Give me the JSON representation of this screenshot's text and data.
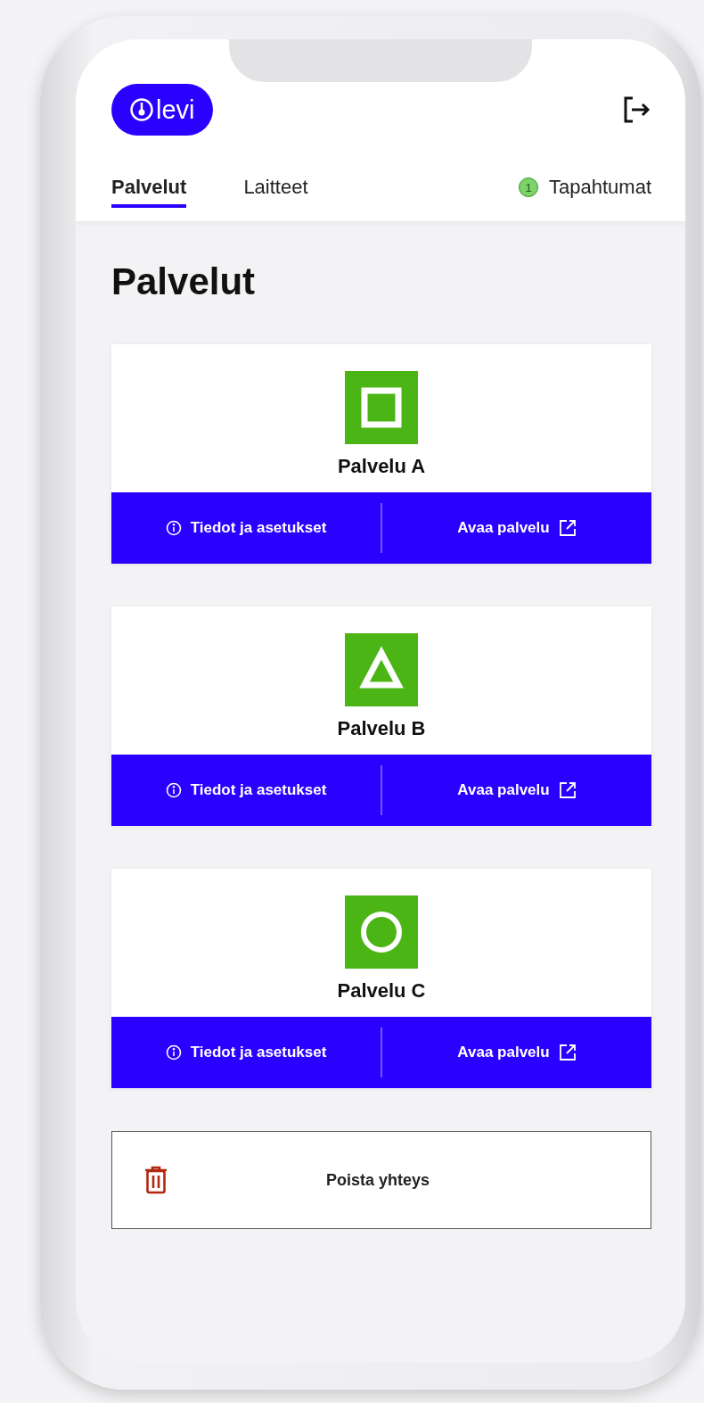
{
  "logo": {
    "text": "levi"
  },
  "tabs": [
    {
      "label": "Palvelut",
      "selected": true
    },
    {
      "label": "Laitteet",
      "selected": false
    },
    {
      "label": "Tapahtumat",
      "selected": false,
      "badge": "1"
    }
  ],
  "heading": "Palvelut",
  "services": [
    {
      "name": "Palvelu A",
      "kind": "square",
      "info_label": "Tiedot ja asetukset",
      "open_label": "Avaa palvelu"
    },
    {
      "name": "Palvelu B",
      "kind": "triangle",
      "info_label": "Tiedot ja asetukset",
      "open_label": "Avaa palvelu"
    },
    {
      "name": "Palvelu C",
      "kind": "circle",
      "info_label": "Tiedot ja asetukset",
      "open_label": "Avaa palvelu"
    }
  ],
  "delete_button": {
    "label": "Poista yhteys"
  }
}
